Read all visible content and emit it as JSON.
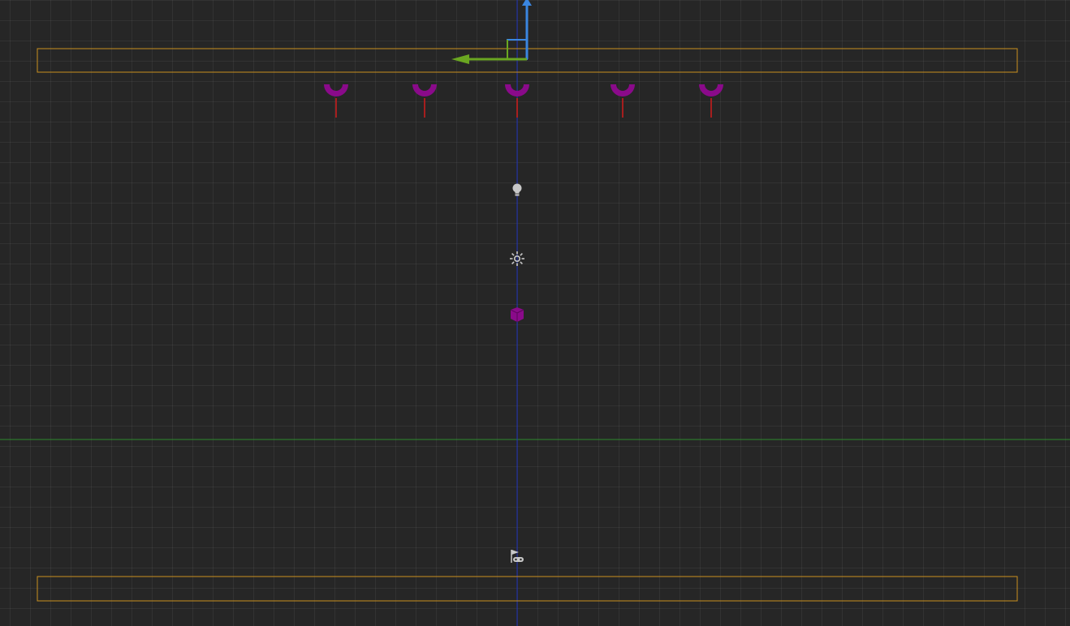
{
  "viewport": {
    "grid_visible": true,
    "background_color": "#262626",
    "axis_colors": {
      "x_axis_line": "#2e8b2e",
      "vertical_axis_line": "#1c2fb8"
    }
  },
  "selection_bounds": {
    "color": "#c9901f"
  },
  "transform_gizmo": {
    "up_axis_color": "#3a86e0",
    "left_axis_color": "#6aa621"
  },
  "spawn_markers": {
    "count": 5,
    "color": "#8a0a8a",
    "tick_color": "#d11b1b",
    "icon": "magnet-icon"
  },
  "scene_icons": {
    "light_icon": "lightbulb-icon",
    "sun_icon": "sun-icon",
    "object_icon": "cube-icon",
    "player_icon": "player-start-icon",
    "icon_color": "#c8c8c8",
    "object_color": "#8a0a8a"
  }
}
